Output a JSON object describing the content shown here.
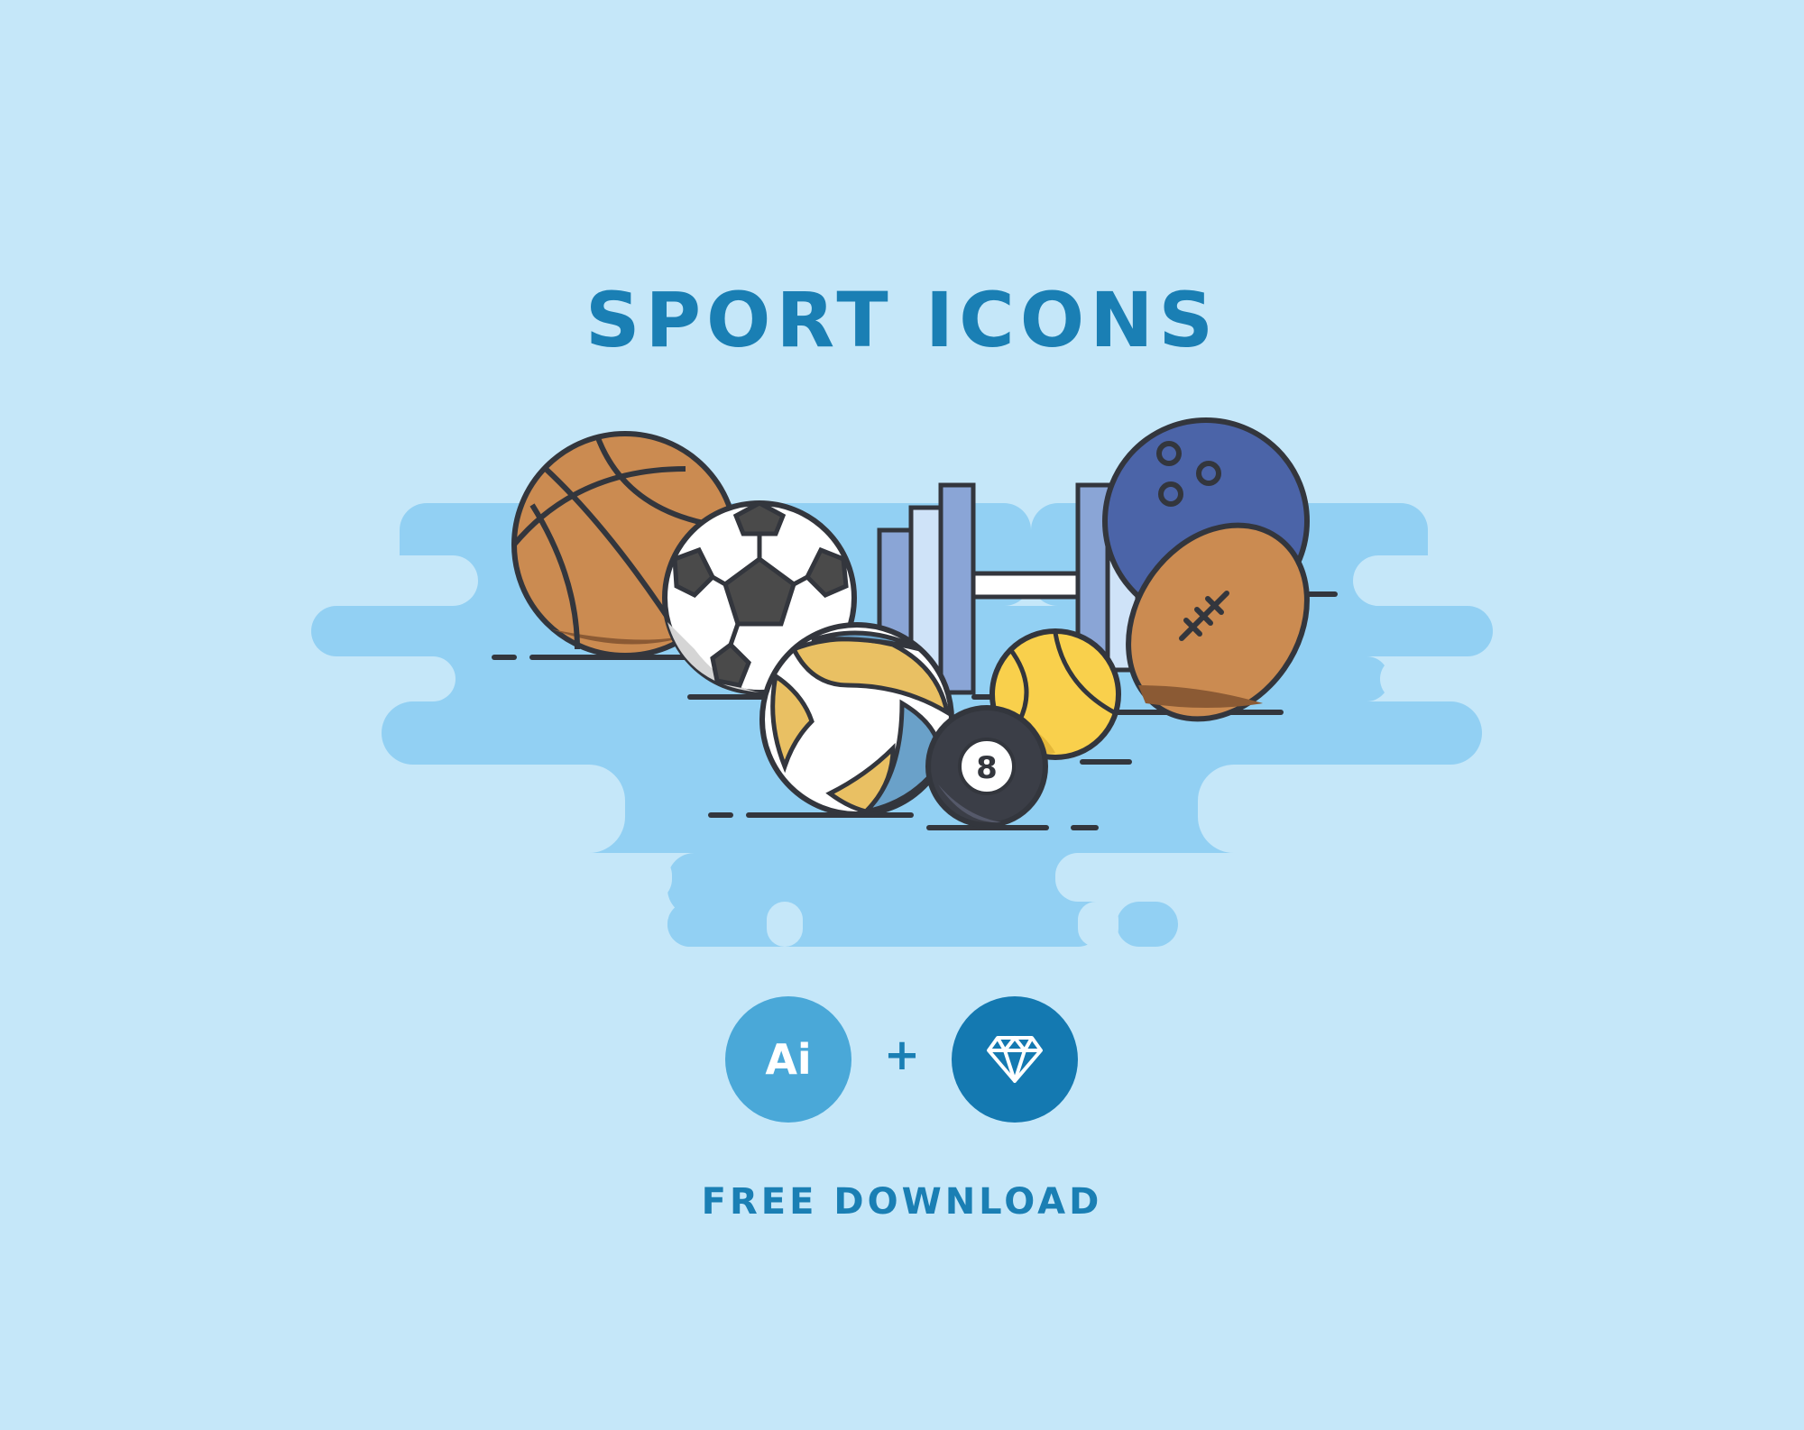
{
  "header": {
    "title": "SPORT ICONS"
  },
  "formats": {
    "ai_label": "Ai",
    "separator": "+",
    "sketch_icon": "diamond-icon"
  },
  "footer": {
    "cta": "FREE DOWNLOAD"
  },
  "illustration": {
    "items": [
      "basketball-icon",
      "soccer-ball-icon",
      "dumbbell-icon",
      "bowling-ball-icon",
      "american-football-icon",
      "volleyball-icon",
      "tennis-ball-icon",
      "billiard-ball-icon"
    ],
    "billiard_number": "8"
  },
  "colors": {
    "background": "#c5e7f9",
    "splash": "#92d0f3",
    "accent": "#1a7fb4",
    "ai_badge": "#4aa8d8",
    "sketch_badge": "#1479b1",
    "outline": "#33363d"
  }
}
